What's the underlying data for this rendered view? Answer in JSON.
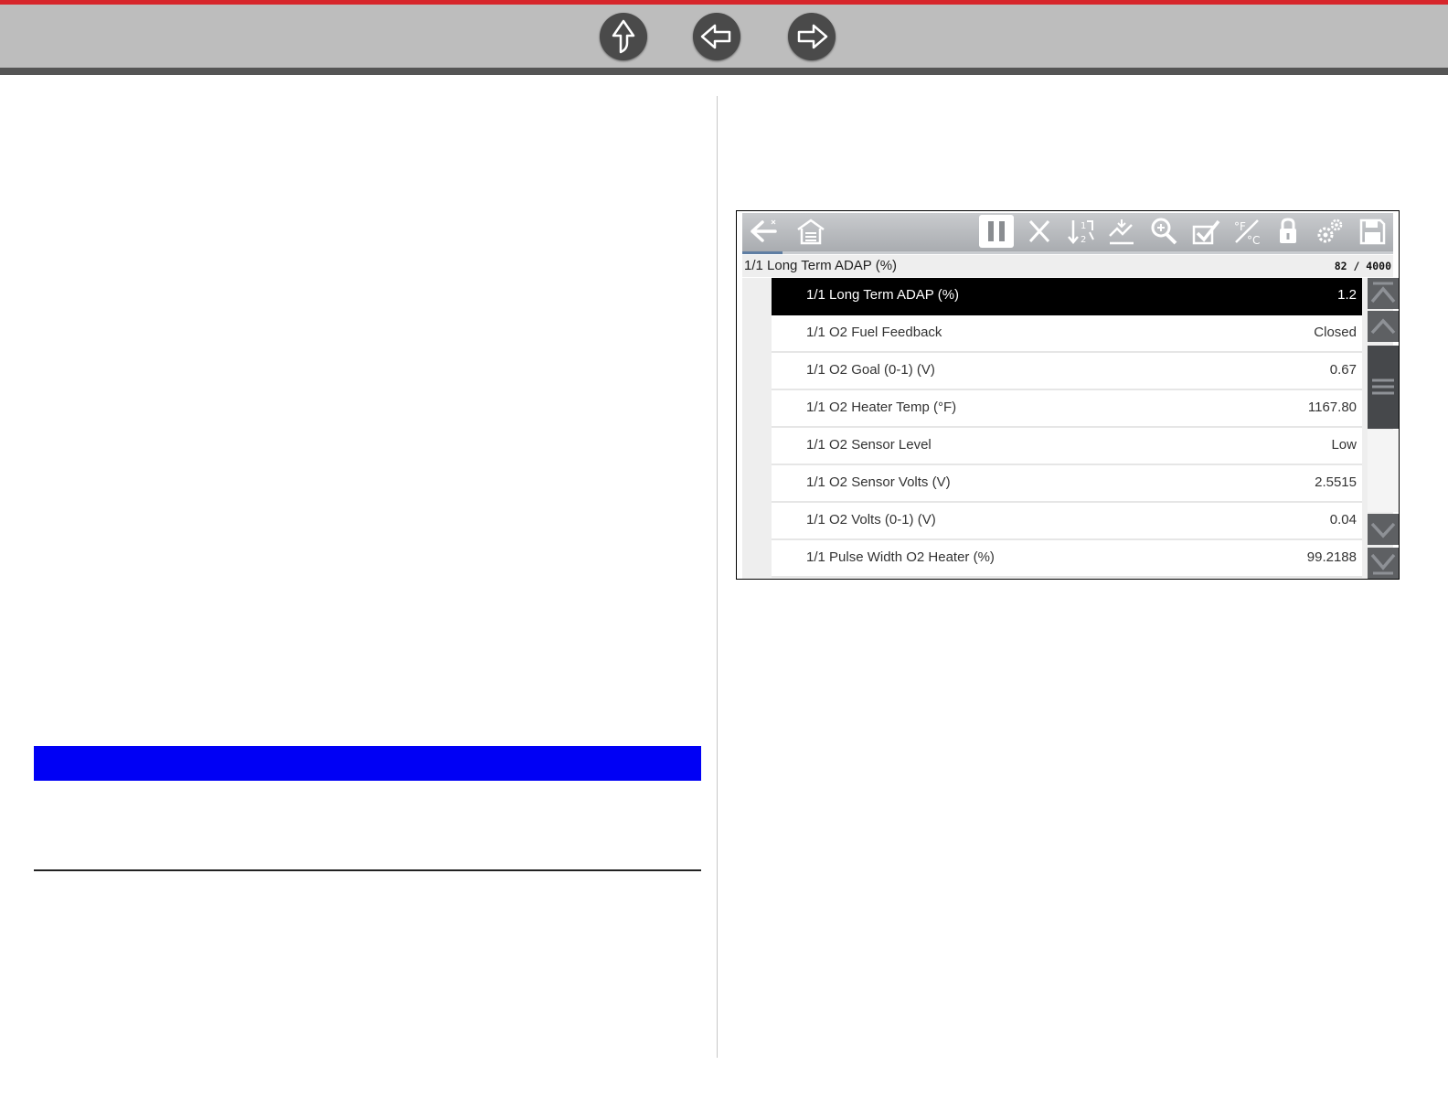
{
  "navigation": {
    "up_label": "",
    "back_label": "",
    "forward_label": ""
  },
  "colors": {
    "top_accent": "#d7262b",
    "banner": "#0000f5",
    "selected_row": "#000000"
  },
  "scan_tool": {
    "toolbar_icons": [
      "back-icon",
      "home-icon",
      "pause-icon",
      "clear-icon",
      "sort-icon",
      "graph-icon",
      "zoom-icon",
      "select-icon",
      "units-icon",
      "lock-icon",
      "settings-icon",
      "save-icon"
    ],
    "header": {
      "title": "1/1 Long Term ADAP (%)",
      "count": "82 / 4000"
    },
    "rows": [
      {
        "label": "1/1 Long Term ADAP (%)",
        "value": "1.2",
        "selected": true
      },
      {
        "label": "1/1 O2 Fuel Feedback",
        "value": "Closed",
        "selected": false
      },
      {
        "label": "1/1 O2 Goal (0-1) (V)",
        "value": "0.67",
        "selected": false
      },
      {
        "label": "1/1 O2 Heater Temp (°F)",
        "value": "1167.80",
        "selected": false
      },
      {
        "label": "1/1 O2 Sensor Level",
        "value": "Low",
        "selected": false
      },
      {
        "label": "1/1 O2 Sensor Volts (V)",
        "value": "2.5515",
        "selected": false
      },
      {
        "label": "1/1 O2 Volts (0-1) (V)",
        "value": "0.04",
        "selected": false
      },
      {
        "label": "1/1 Pulse Width O2 Heater (%)",
        "value": "99.2188",
        "selected": false
      }
    ]
  }
}
